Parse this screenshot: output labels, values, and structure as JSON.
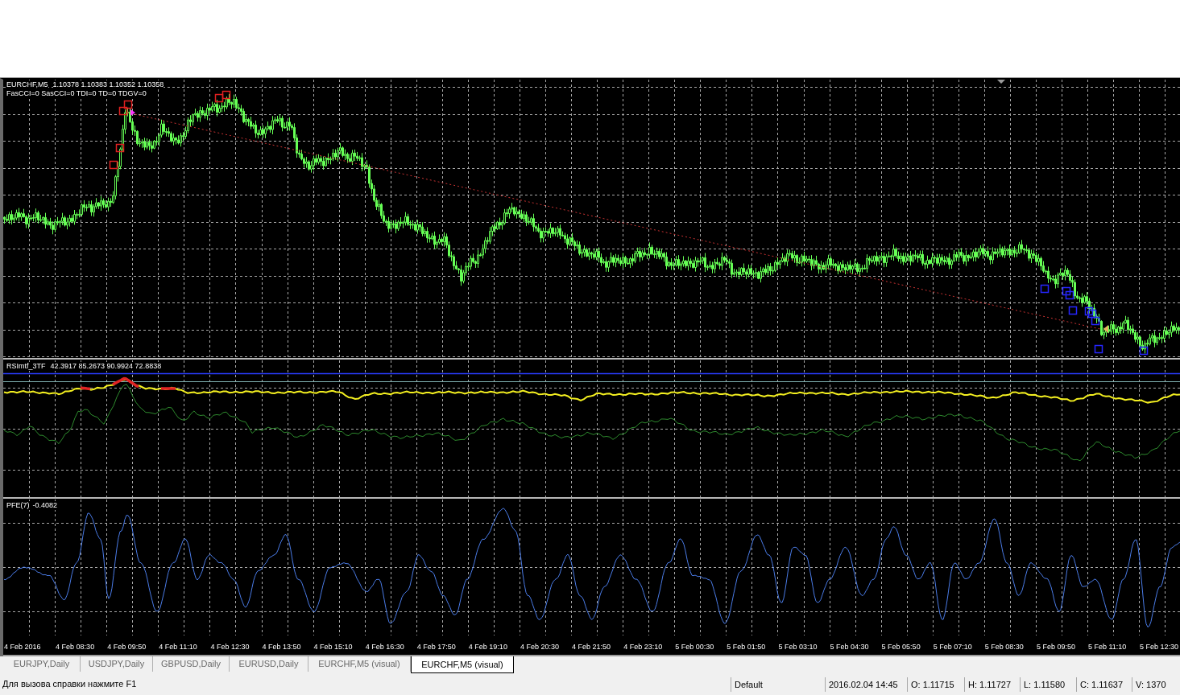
{
  "chart_window": {
    "main_pane": {
      "symbol": "EURCHF,M5",
      "prices": "1.10378 1.10383 1.10352 1.10358",
      "indicator_status": "FasCCI=0 SasCCI=0 TDI=0 TD=0 TDGV=0"
    },
    "rsi_pane": {
      "name": "RSImtf_3TF",
      "values": "42.3917 85.2673 90.9924 72.8838"
    },
    "pfe_pane": {
      "name": "PFE(7)",
      "value": "-0.4082"
    },
    "time_axis": [
      "4 Feb 2016",
      "4 Feb 08:30",
      "4 Feb 09:50",
      "4 Feb 11:10",
      "4 Feb 12:30",
      "4 Feb 13:50",
      "4 Feb 15:10",
      "4 Feb 16:30",
      "4 Feb 17:50",
      "4 Feb 19:10",
      "4 Feb 20:30",
      "4 Feb 21:50",
      "4 Feb 23:10",
      "5 Feb 00:30",
      "5 Feb 01:50",
      "5 Feb 03:10",
      "5 Feb 04:30",
      "5 Feb 05:50",
      "5 Feb 07:10",
      "5 Feb 08:30",
      "5 Feb 09:50",
      "5 Feb 11:10",
      "5 Feb 12:30"
    ]
  },
  "tabs": [
    {
      "label": "EURJPY,Daily",
      "selected": false
    },
    {
      "label": "USDJPY,Daily",
      "selected": false
    },
    {
      "label": "GBPUSD,Daily",
      "selected": false
    },
    {
      "label": "EURUSD,Daily",
      "selected": false
    },
    {
      "label": "EURCHF,M5 (visual)",
      "selected": false
    },
    {
      "label": "EURCHF,M5 (visual)",
      "selected": true
    }
  ],
  "status_bar": {
    "help_text": "Для вызова справки нажмите F1",
    "profile": "Default",
    "datetime": "2016.02.04 14:45",
    "open": "O: 1.11715",
    "high": "H: 1.11727",
    "low": "L: 1.11580",
    "close": "C: 1.11637",
    "volume": "V: 1370"
  }
}
